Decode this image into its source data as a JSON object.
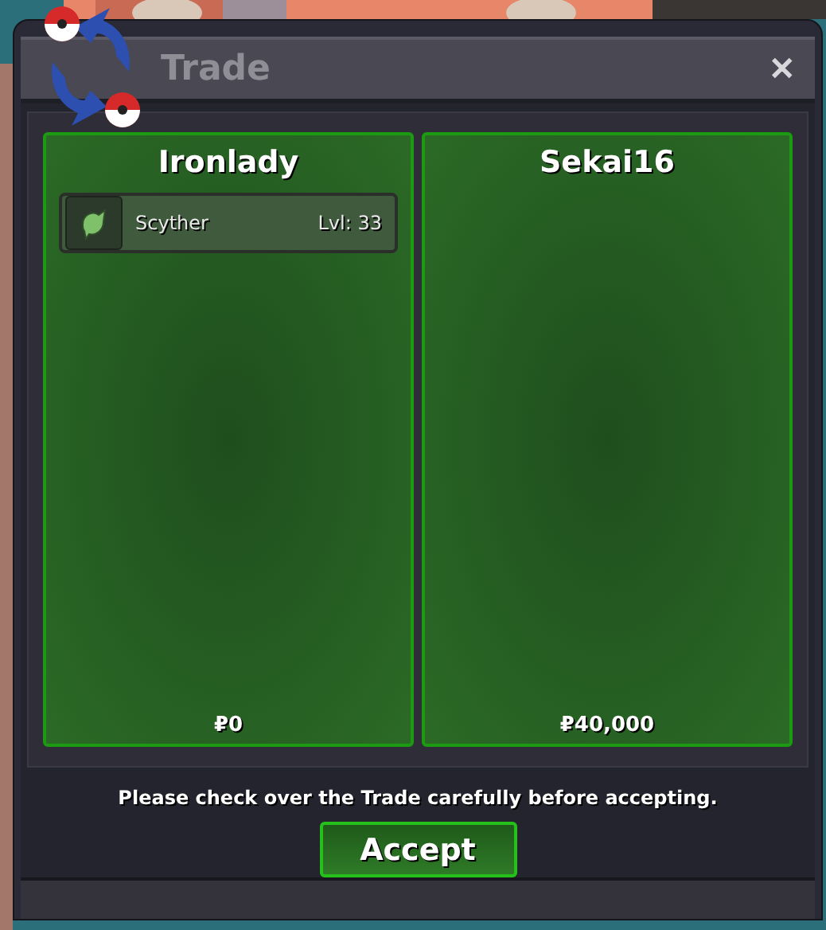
{
  "window": {
    "title": "Trade",
    "close": "✕"
  },
  "traders": [
    {
      "name": "Ironlady",
      "items": [
        {
          "name": "Scyther",
          "level": "Lvl: 33"
        }
      ],
      "money": "₽0"
    },
    {
      "name": "Sekai16",
      "money": "₽40,000"
    }
  ],
  "notice": "Please check over the Trade carefully before accepting.",
  "accept_button": "Accept"
}
